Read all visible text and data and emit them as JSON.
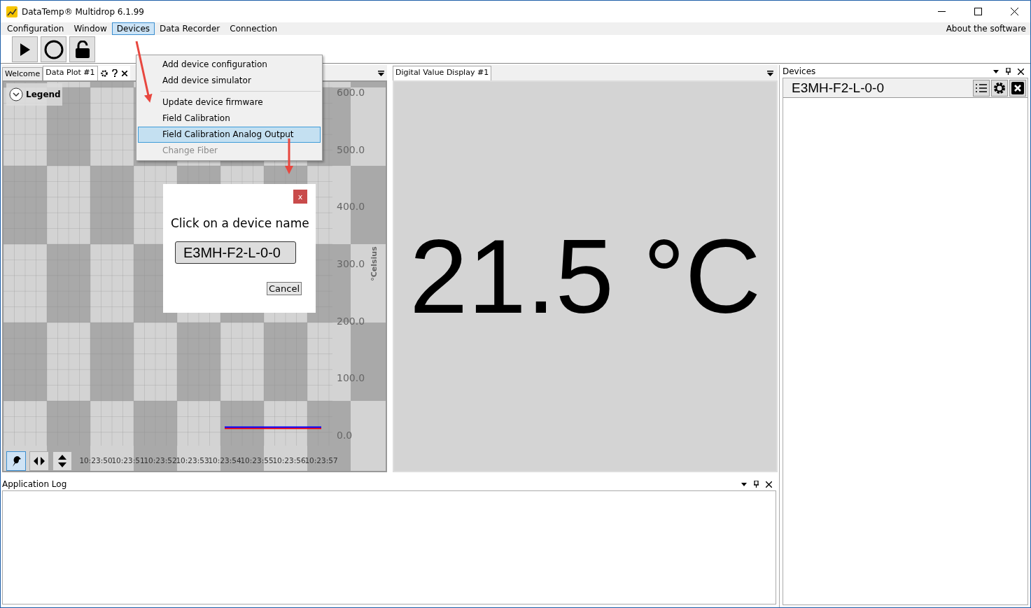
{
  "window": {
    "title": "DataTemp® Multidrop 6.1.99"
  },
  "menu_bar": {
    "items": [
      {
        "label": "Configuration",
        "selected": false
      },
      {
        "label": "Window",
        "selected": false
      },
      {
        "label": "Devices",
        "selected": true
      },
      {
        "label": "Data Recorder",
        "selected": false
      },
      {
        "label": "Connection",
        "selected": false
      }
    ],
    "about": "About the software"
  },
  "devices_menu": {
    "items": [
      {
        "label": "Add device configuration",
        "selected": false,
        "disabled": false,
        "separator_before": false
      },
      {
        "label": "Add device simulator",
        "selected": false,
        "disabled": false,
        "separator_before": false
      },
      {
        "label": "Update device firmware",
        "selected": false,
        "disabled": false,
        "separator_before": true
      },
      {
        "label": "Field Calibration",
        "selected": false,
        "disabled": false,
        "separator_before": false
      },
      {
        "label": "Field Calibration Analog Output",
        "selected": true,
        "disabled": false,
        "separator_before": false
      },
      {
        "label": "Change Fiber",
        "selected": false,
        "disabled": true,
        "separator_before": false
      }
    ]
  },
  "plot_panel": {
    "tabs": [
      {
        "label": "Welcome",
        "selected": false
      },
      {
        "label": "Data Plot #1",
        "selected": true
      }
    ],
    "legend": "Legend",
    "chart_data": {
      "type": "line",
      "ylabel": "°Celsius",
      "categories": [
        "10:23:50",
        "10:23:51",
        "10:23:52",
        "10:23:53",
        "10:23:54",
        "10:23:55",
        "10:23:56",
        "10:23:57"
      ],
      "series": [
        {
          "color": "#ff0000",
          "values": [
            null,
            null,
            null,
            null,
            12,
            12,
            12,
            12
          ]
        },
        {
          "color": "#0000ff",
          "values": [
            null,
            null,
            null,
            null,
            14,
            14,
            14,
            14
          ]
        }
      ],
      "ylim": [
        0,
        600
      ],
      "yticks": [
        {
          "value": 0,
          "label": "0.0"
        },
        {
          "value": 100,
          "label": "100.0"
        },
        {
          "value": 200,
          "label": "200.0"
        },
        {
          "value": 300,
          "label": "300.0"
        },
        {
          "value": 400,
          "label": "400.0"
        },
        {
          "value": 500,
          "label": "500.0"
        },
        {
          "value": 600,
          "label": "600.0"
        }
      ],
      "grid": true
    }
  },
  "dialog": {
    "prompt": "Click on a device name",
    "device": "E3MH-F2-L-0-0",
    "cancel": "Cancel",
    "close": "x"
  },
  "display_panel": {
    "tab": "Digital Value Display #1",
    "value": "21.5 °C"
  },
  "devices_panel": {
    "title": "Devices",
    "devices": [
      {
        "name": "E3MH-F2-L-0-0"
      }
    ]
  },
  "log_panel": {
    "title": "Application Log"
  }
}
